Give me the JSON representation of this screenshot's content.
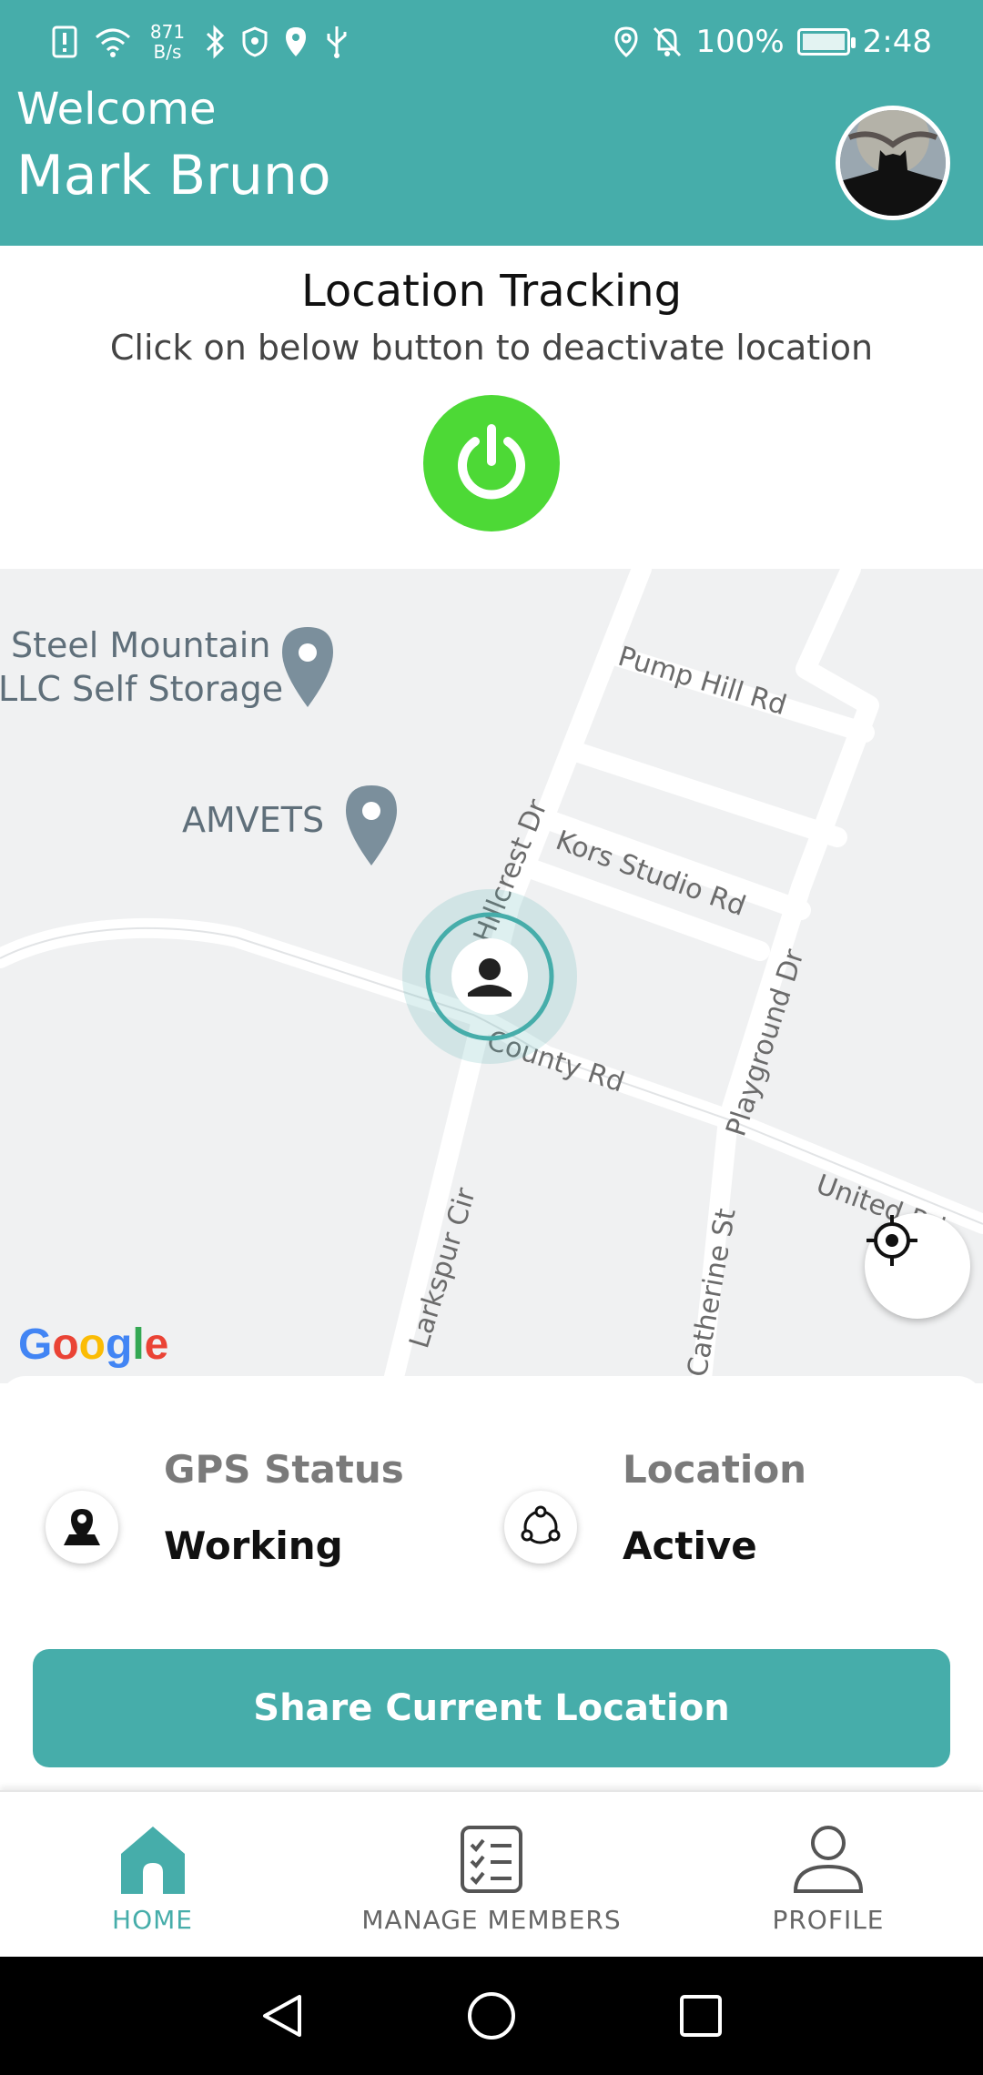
{
  "status_bar": {
    "net_speed": "871\nB/s",
    "net_speed_top": "871",
    "net_speed_bottom": "B/s",
    "battery": "100%",
    "time": "2:48"
  },
  "header": {
    "welcome": "Welcome",
    "user_name": "Mark Bruno"
  },
  "tracking": {
    "title": "Location Tracking",
    "subtitle": "Click on below button to deactivate location",
    "state_color": "#4DD936"
  },
  "map": {
    "pois": [
      {
        "line1": "Steel Mountain",
        "line2": "LLC Self Storage"
      },
      {
        "line1": "AMVETS",
        "line2": ""
      }
    ],
    "streets": [
      "Pump Hill Rd",
      "Kors Studio Rd",
      "Hillcrest Dr",
      "County Rd",
      "Playground Dr",
      "United Rd",
      "Larkspur Cir",
      "Catherine St"
    ],
    "attribution": "Google"
  },
  "status": {
    "gps_label": "GPS Status",
    "gps_value": "Working",
    "location_label": "Location",
    "location_value": "Active"
  },
  "share_button": "Share Current Location",
  "bottom_nav": [
    {
      "label": "HOME",
      "icon": "home-icon",
      "active": true
    },
    {
      "label": "MANAGE MEMBERS",
      "icon": "checklist-icon",
      "active": false
    },
    {
      "label": "PROFILE",
      "icon": "person-icon",
      "active": false
    }
  ],
  "colors": {
    "primary": "#46ADAA",
    "power_on": "#4DD936",
    "map_bg": "#F0F1F2"
  }
}
